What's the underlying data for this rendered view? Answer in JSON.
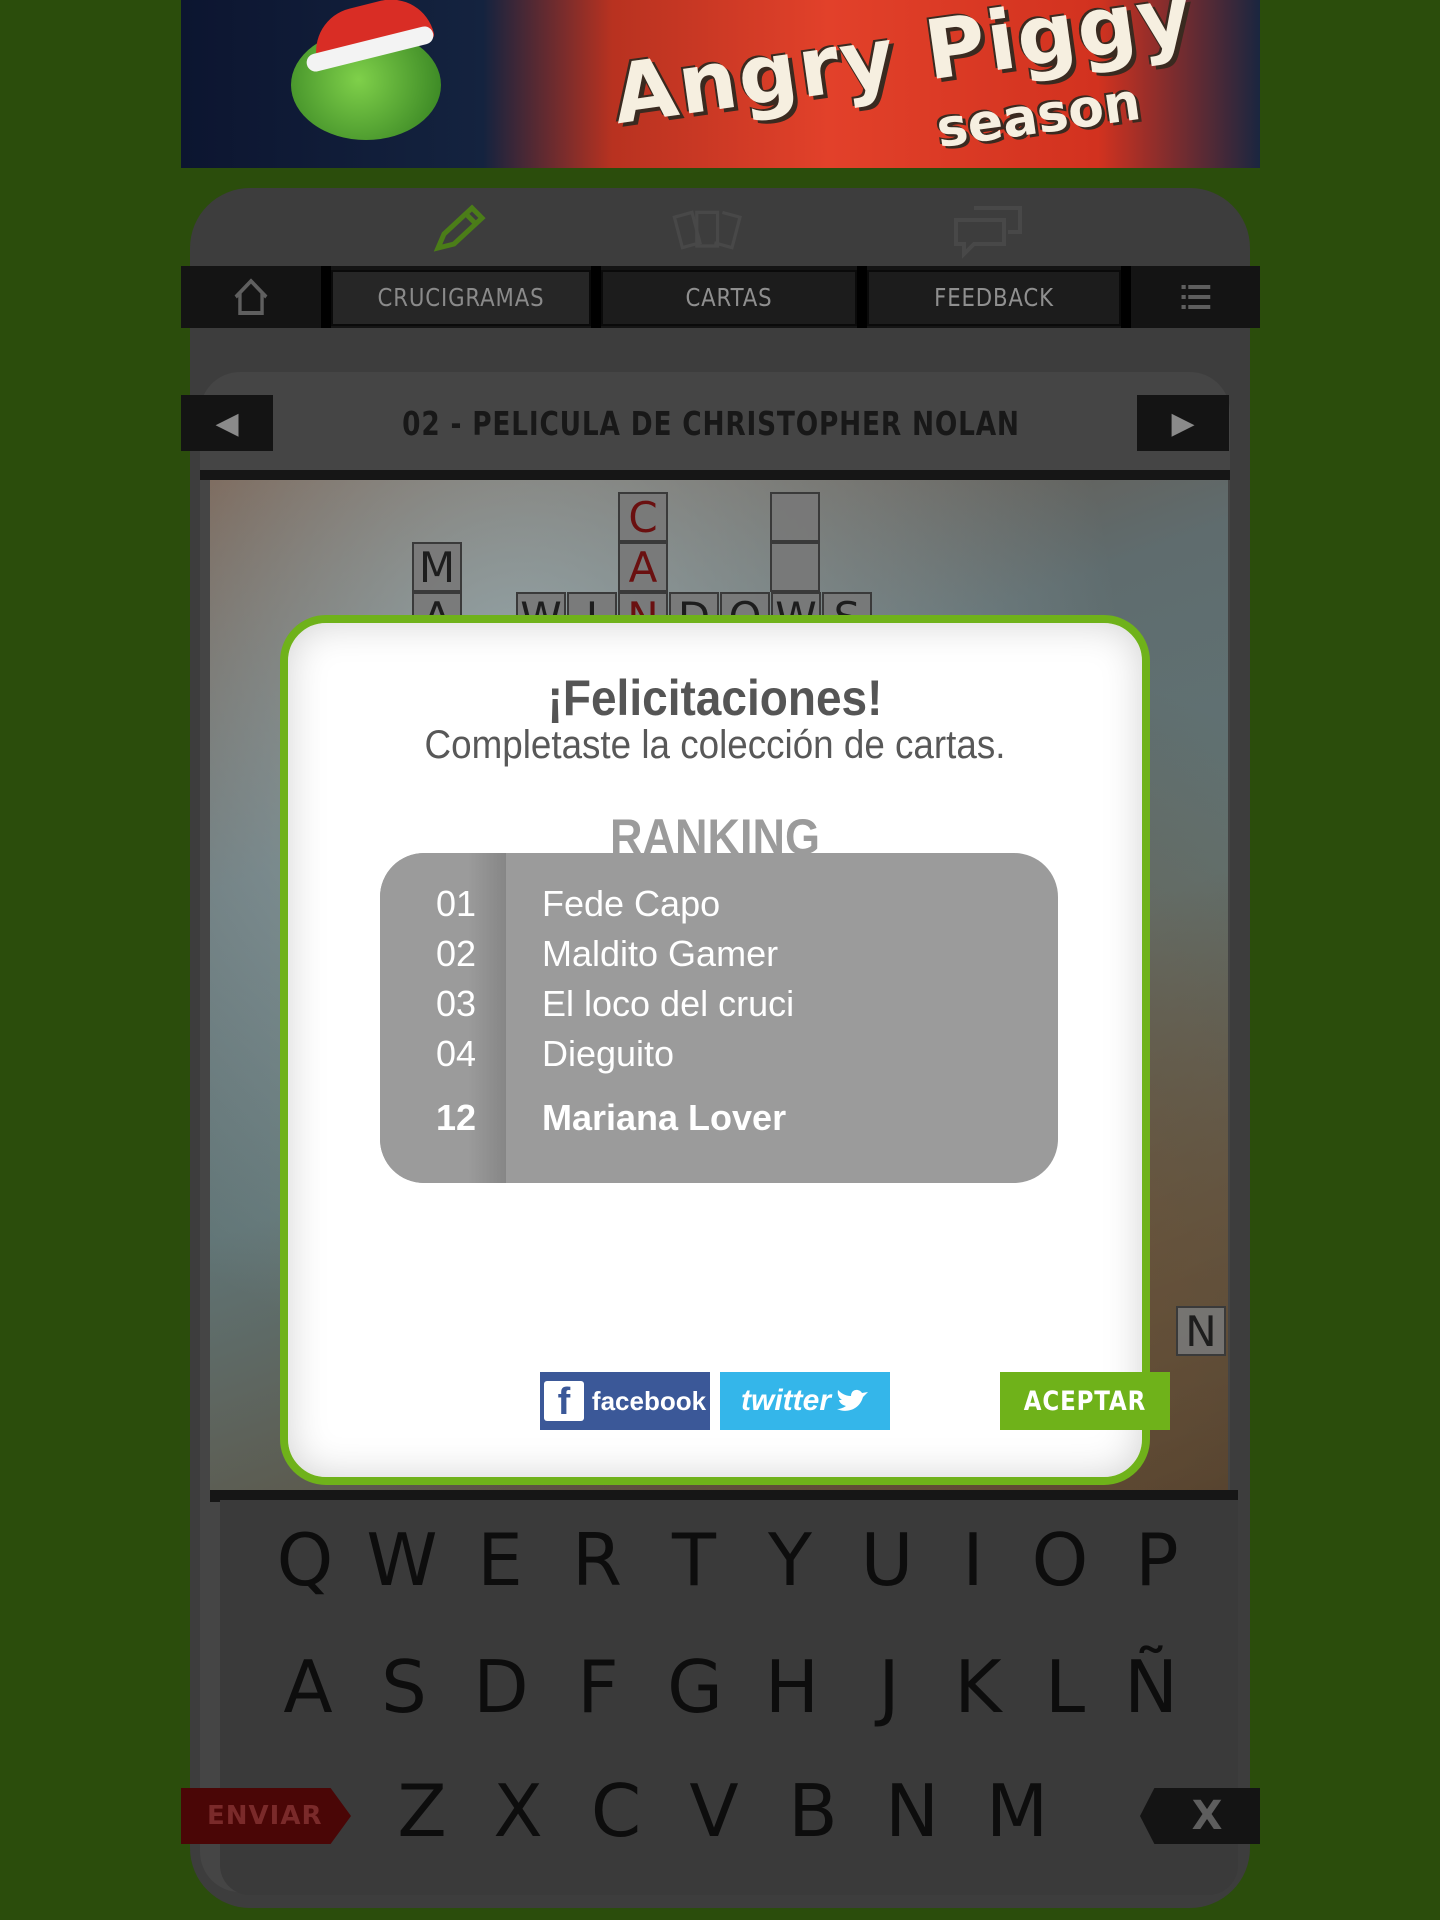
{
  "banner": {
    "title_line1": "Angry Piggy",
    "title_line2": "season"
  },
  "nav": {
    "home_icon": "home-icon",
    "tabs": [
      {
        "label": "CRUCIGRAMAS",
        "icon": "pencil-icon"
      },
      {
        "label": "CARTAS",
        "icon": "cards-icon"
      },
      {
        "label": "FEEDBACK",
        "icon": "chat-bubbles-icon"
      }
    ],
    "menu_icon": "list-icon"
  },
  "level": {
    "prev_icon": "◀",
    "next_icon": "▶",
    "title": "02 - PELICULA DE CHRISTOPHER NOLAN"
  },
  "puzzle": {
    "cells": [
      "C",
      "A",
      "M",
      "A",
      "W",
      "I",
      "N",
      "D",
      "O",
      "W",
      "S",
      "N"
    ]
  },
  "keyboard": {
    "row1": [
      "Q",
      "W",
      "E",
      "R",
      "T",
      "Y",
      "U",
      "I",
      "O",
      "P"
    ],
    "row2": [
      "A",
      "S",
      "D",
      "F",
      "G",
      "H",
      "J",
      "K",
      "L",
      "Ñ"
    ],
    "row3": [
      "Z",
      "X",
      "C",
      "V",
      "B",
      "N",
      "M"
    ],
    "send_label": "ENVIAR",
    "delete_label": "X"
  },
  "modal": {
    "title": "¡Felicitaciones!",
    "subtitle": "Completaste la colección de cartas.",
    "ranking_title": "RANKING",
    "ranking": [
      {
        "pos": "01",
        "name": "Fede Capo"
      },
      {
        "pos": "02",
        "name": "Maldito Gamer"
      },
      {
        "pos": "03",
        "name": "El loco del cruci"
      },
      {
        "pos": "04",
        "name": "Dieguito"
      }
    ],
    "my_rank": {
      "pos": "12",
      "name": "Mariana Lover"
    },
    "facebook_label": "facebook",
    "twitter_label": "twitter",
    "accept_label": "ACEPTAR"
  },
  "colors": {
    "background": "#2b4d0c",
    "accent_green": "#6fb21a",
    "facebook_blue": "#3b5898",
    "twitter_blue": "#34b6ea",
    "send_red": "#4a0606"
  }
}
